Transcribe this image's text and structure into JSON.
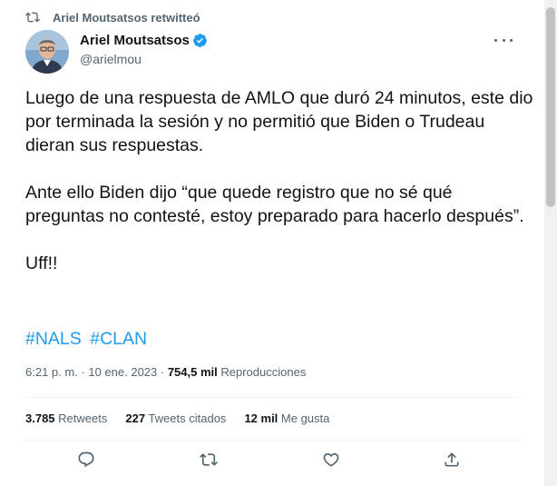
{
  "social_context": {
    "text": "Ariel Moutsatsos retwitteó",
    "icon": "retweet-icon"
  },
  "author": {
    "name": "Ariel Moutsatsos",
    "handle": "@arielmou",
    "verified_icon": "verified-badge-icon"
  },
  "tweet": {
    "paragraphs": [
      "Luego de una respuesta de AMLO que duró 24 minutos, este dio por terminada la sesión y no permitió que Biden o Trudeau dieran sus respuestas.",
      "Ante ello Biden dijo “que quede registro que no sé qué preguntas no contesté, estoy preparado para hacerlo después”.",
      "Uff!!"
    ],
    "hashtags": [
      "#NALS",
      "#CLAN"
    ]
  },
  "meta": {
    "time_date": "6:21 p. m. · 10 ene. 2023 · ",
    "views_count": "754,5 mil",
    "views_label": " Reproducciones"
  },
  "stats": {
    "retweets_count": "3.785",
    "retweets_label": " Retweets",
    "quotes_count": "227",
    "quotes_label": " Tweets citados",
    "likes_count": "12 mil",
    "likes_label": " Me gusta"
  },
  "colors": {
    "accent": "#1d9bf0",
    "muted": "#536471",
    "text": "#0f1419"
  }
}
